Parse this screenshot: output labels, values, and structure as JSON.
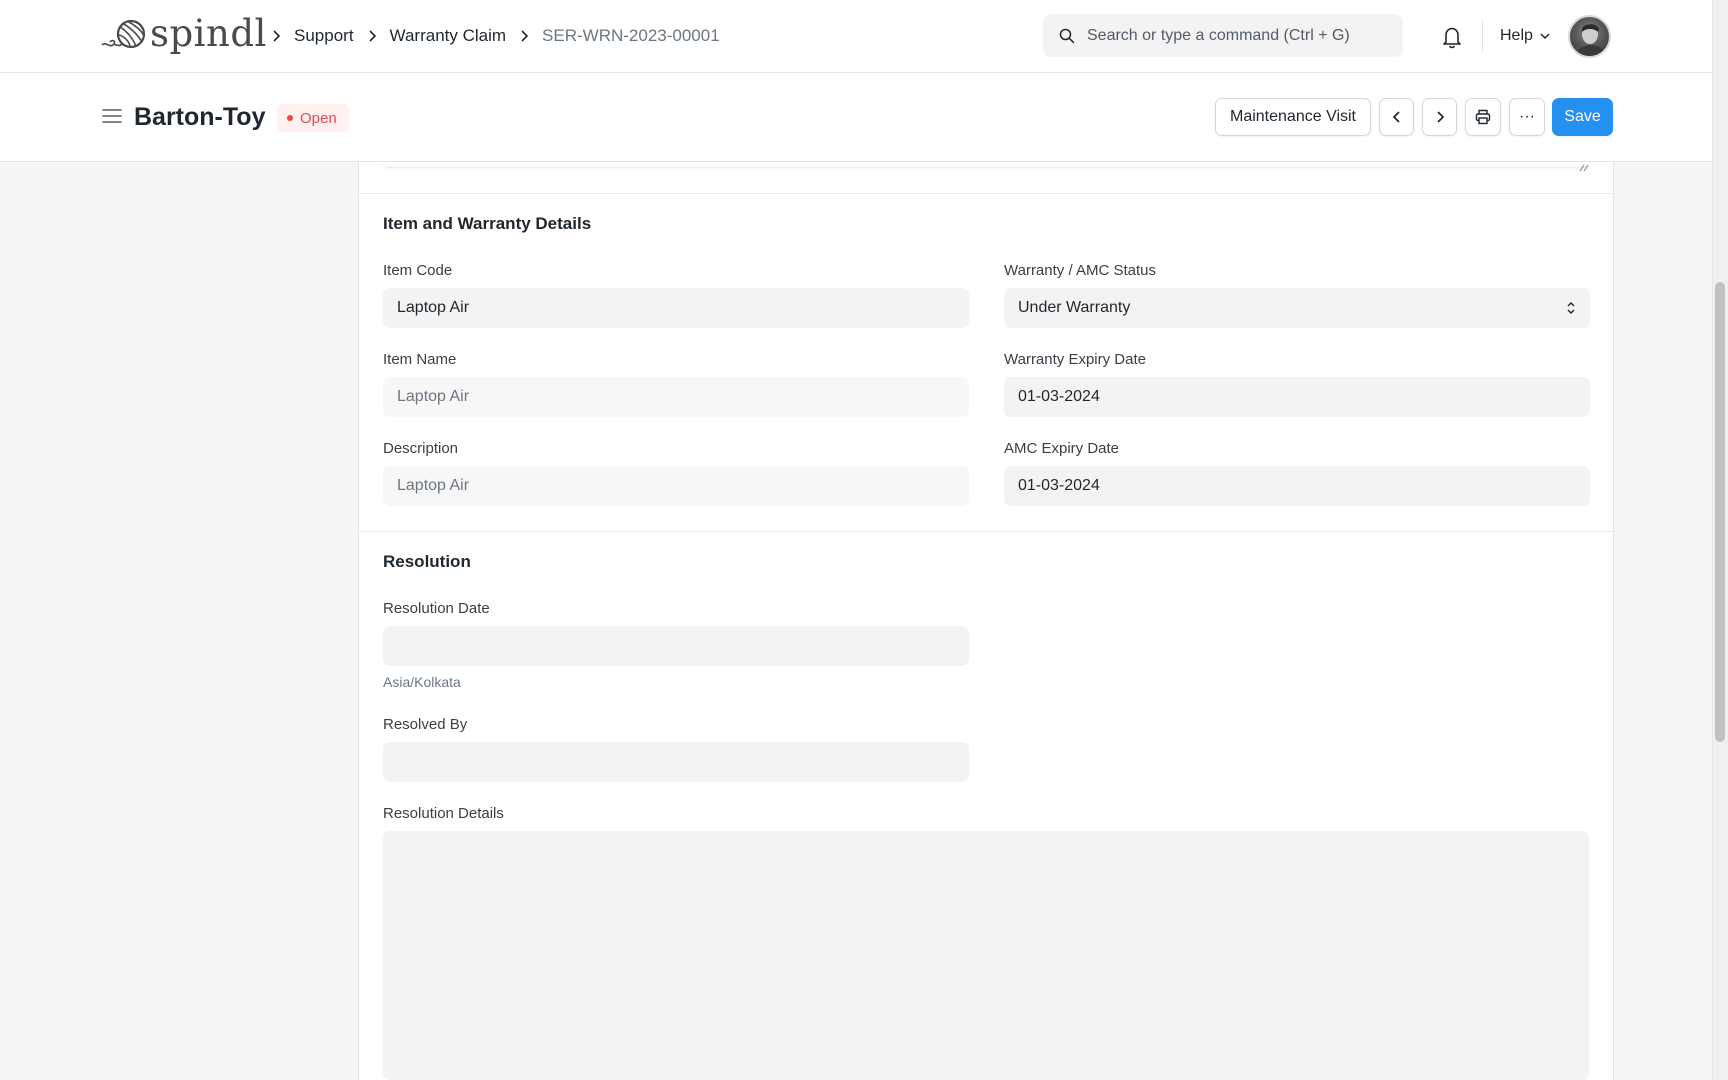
{
  "app": {
    "logo_text": "spindl"
  },
  "breadcrumbs": [
    "Support",
    "Warranty Claim",
    "SER-WRN-2023-00001"
  ],
  "search": {
    "placeholder": "Search or type a command (Ctrl + G)"
  },
  "navbar": {
    "help_label": "Help"
  },
  "page": {
    "title": "Barton-Toy",
    "status": "Open",
    "status_color": "#e24c4c"
  },
  "actions": {
    "maintenance_visit": "Maintenance Visit",
    "more": "···",
    "save": "Save"
  },
  "colors": {
    "accent": "#2490ef"
  },
  "item_section": {
    "title": "Item and Warranty Details",
    "item_code": {
      "label": "Item Code",
      "value": "Laptop Air"
    },
    "item_name": {
      "label": "Item Name",
      "value": "Laptop Air"
    },
    "description": {
      "label": "Description",
      "value": "Laptop Air"
    },
    "warranty_status": {
      "label": "Warranty / AMC Status",
      "value": "Under Warranty"
    },
    "warranty_expiry": {
      "label": "Warranty Expiry Date",
      "value": "01-03-2024"
    },
    "amc_expiry": {
      "label": "AMC Expiry Date",
      "value": "01-03-2024"
    }
  },
  "resolution_section": {
    "title": "Resolution",
    "resolution_date": {
      "label": "Resolution Date",
      "value": "",
      "timezone": "Asia/Kolkata"
    },
    "resolved_by": {
      "label": "Resolved By",
      "value": ""
    },
    "resolution_details": {
      "label": "Resolution Details",
      "value": ""
    }
  }
}
